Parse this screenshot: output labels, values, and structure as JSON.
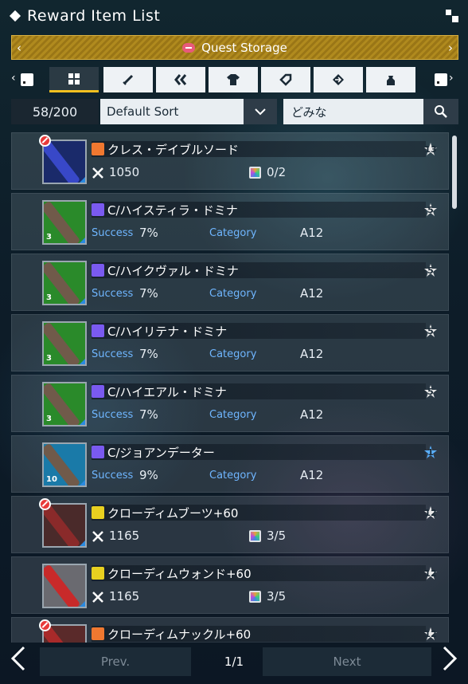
{
  "window": {
    "title": "Reward Item List"
  },
  "storage": {
    "label": "Quest Storage",
    "color": "#b08a1e"
  },
  "tabs": [
    {
      "icon": "grid-icon",
      "active": true
    },
    {
      "icon": "sword-icon",
      "active": false
    },
    {
      "icon": "double-chevron-icon",
      "active": false
    },
    {
      "icon": "shirt-icon",
      "active": false
    },
    {
      "icon": "tag-icon",
      "active": false
    },
    {
      "icon": "arrow-right-icon",
      "active": false
    },
    {
      "icon": "bag-icon",
      "active": false
    }
  ],
  "toolbar": {
    "count": "58/200",
    "sort": "Default Sort",
    "search_value": "どみな"
  },
  "items": [
    {
      "name": "クレス・デイブルソード",
      "kind": "weapon",
      "type_color": "#f07830",
      "thumb_bg": "#1a2a6a",
      "bar_color": "#3848c8",
      "locked": true,
      "qty": "",
      "rank": "13",
      "atk": "1050",
      "slots": "0/2"
    },
    {
      "name": "C/ハイスティラ・ドミナ",
      "kind": "disc",
      "type_color": "#7a5af0",
      "thumb_bg": "#2a8a2a",
      "bar_color": "#705a4a",
      "locked": false,
      "qty": "3",
      "rank": "5",
      "success_label": "Success",
      "success": "7%",
      "category_label": "Category",
      "category": "A12"
    },
    {
      "name": "C/ハイクヴァル・ドミナ",
      "kind": "disc",
      "type_color": "#7a5af0",
      "thumb_bg": "#2a8a2a",
      "bar_color": "#705a4a",
      "locked": false,
      "qty": "3",
      "rank": "5",
      "success_label": "Success",
      "success": "7%",
      "category_label": "Category",
      "category": "A12"
    },
    {
      "name": "C/ハイリテナ・ドミナ",
      "kind": "disc",
      "type_color": "#7a5af0",
      "thumb_bg": "#2a8a2a",
      "bar_color": "#705a4a",
      "locked": false,
      "qty": "3",
      "rank": "5",
      "success_label": "Success",
      "success": "7%",
      "category_label": "Category",
      "category": "A12"
    },
    {
      "name": "C/ハイエアル・ドミナ",
      "kind": "disc",
      "type_color": "#7a5af0",
      "thumb_bg": "#2a8a2a",
      "bar_color": "#705a4a",
      "locked": false,
      "qty": "3",
      "rank": "5",
      "success_label": "Success",
      "success": "7%",
      "category_label": "Category",
      "category": "A12"
    },
    {
      "name": "C/ジョアンデーター",
      "kind": "disc",
      "type_color": "#7a5af0",
      "thumb_bg": "#1a7aa8",
      "bar_color": "#705a4a",
      "locked": false,
      "qty": "10",
      "rank": "1",
      "success_label": "Success",
      "success": "9%",
      "category_label": "Category",
      "category": "A12"
    },
    {
      "name": "クローディムブーツ+60",
      "kind": "weapon",
      "type_color": "#e8d020",
      "thumb_bg": "#4a2a2a",
      "bar_color": "#8a2a2a",
      "locked": true,
      "qty": "",
      "rank": "12",
      "atk": "1165",
      "slots": "3/5"
    },
    {
      "name": "クローディムウォンド+60",
      "kind": "weapon",
      "type_color": "#e8d020",
      "thumb_bg": "#6a6a70",
      "bar_color": "#c82a2a",
      "locked": false,
      "qty": "",
      "rank": "12",
      "atk": "1165",
      "slots": "3/5"
    },
    {
      "name": "クローディムナックル+60",
      "kind": "weapon",
      "type_color": "#f07830",
      "thumb_bg": "#5a2a2a",
      "bar_color": "#a82a2a",
      "locked": true,
      "qty": "",
      "rank": "12",
      "atk": "",
      "slots": ""
    }
  ],
  "pager": {
    "prev": "Prev.",
    "page": "1/1",
    "next": "Next"
  }
}
